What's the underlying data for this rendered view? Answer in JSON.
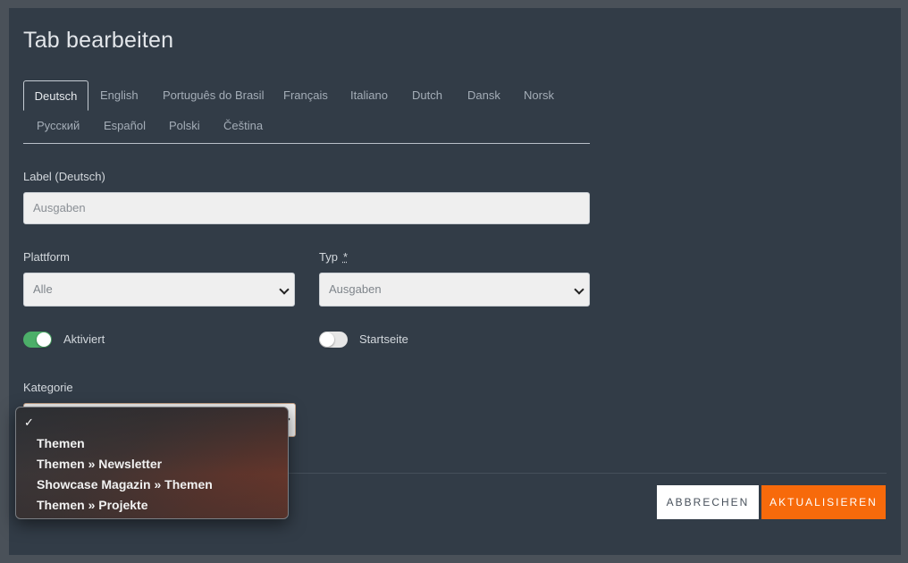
{
  "dialog": {
    "title": "Tab bearbeiten"
  },
  "tabs": [
    {
      "label": "Deutsch",
      "active": true
    },
    {
      "label": "English"
    },
    {
      "label": "Português do Brasil"
    },
    {
      "label": "Français"
    },
    {
      "label": "Italiano"
    },
    {
      "label": "Dutch"
    },
    {
      "label": "Dansk"
    },
    {
      "label": "Norsk"
    },
    {
      "label": "Русский"
    },
    {
      "label": "Español"
    },
    {
      "label": "Polski"
    },
    {
      "label": "Čeština"
    }
  ],
  "form": {
    "label_field": {
      "label": "Label (Deutsch)",
      "placeholder": "Ausgaben"
    },
    "plattform": {
      "label": "Plattform",
      "value": "Alle"
    },
    "typ": {
      "label": "Typ",
      "required_mark": "*",
      "value": "Ausgaben"
    },
    "toggles": {
      "aktiviert": {
        "label": "Aktiviert",
        "on": true
      },
      "startseite": {
        "label": "Startseite",
        "on": false
      }
    },
    "kategorie": {
      "label": "Kategorie",
      "selected_mark": "✓",
      "options": [
        "Themen",
        "Themen » Newsletter",
        "Showcase Magazin » Themen",
        "Themen » Projekte"
      ]
    }
  },
  "buttons": {
    "cancel": "ABBRECHEN",
    "update": "AKTUALISIEREN"
  },
  "colors": {
    "accent": "#f76a0b",
    "toggle_on": "#4caf69",
    "panel_bg": "#323c47"
  }
}
